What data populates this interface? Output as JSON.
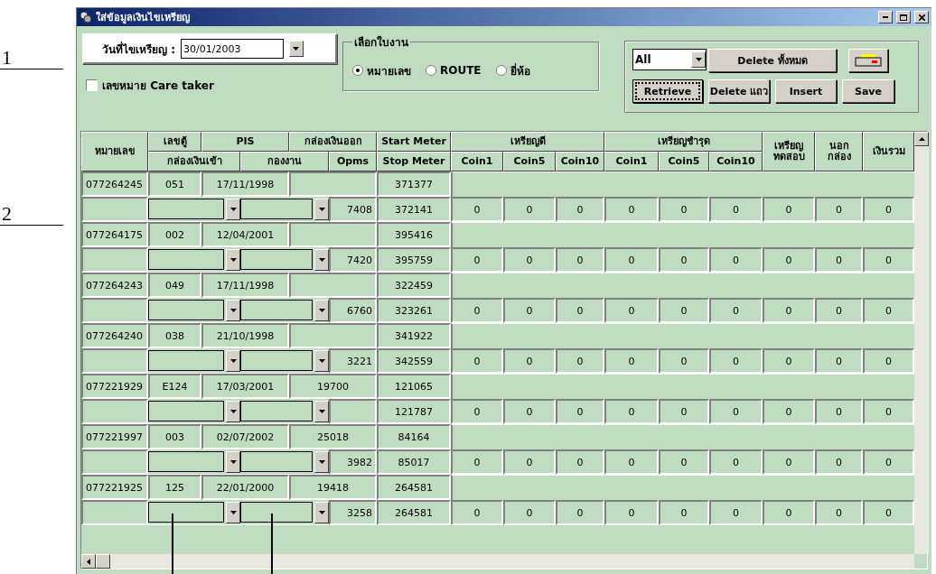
{
  "annotations": [
    {
      "label": "1"
    },
    {
      "label": "2"
    }
  ],
  "window": {
    "title": "ใส่ข้อมูลเงินไขเหรียญ"
  },
  "date_picker": {
    "label": "วันที่ไขเหรียญ :",
    "value": "30/01/2003"
  },
  "caretaker_checkbox": {
    "label": "เลขหมาย Care taker",
    "checked": false
  },
  "worksheet_group": {
    "title": "เลือกใบงาน",
    "options": [
      {
        "label": "หมายเลข",
        "selected": true
      },
      {
        "label": "ROUTE",
        "selected": false
      },
      {
        "label": "ยี่ห้อ",
        "selected": false
      }
    ]
  },
  "filter": {
    "value": "All"
  },
  "buttons": [
    {
      "kind": "text",
      "label": "Delete ทั้งหมด",
      "focused": false
    },
    {
      "kind": "print",
      "focused": false
    },
    {
      "kind": "text",
      "label": "Retrieve",
      "focused": true
    },
    {
      "kind": "text",
      "label": "Delete แถว",
      "focused": false
    },
    {
      "kind": "text",
      "label": "Insert",
      "focused": false
    },
    {
      "kind": "text",
      "label": "Save",
      "focused": false
    }
  ],
  "table": {
    "header_top": [
      "หมายเลข",
      "เลขตู้",
      "PIS",
      "กล่องเงินออก",
      "Start Meter",
      "เหรียญดี",
      "เหรียญชำรุด",
      "เหรียญ ทดสอบ",
      "นอก กล่อง",
      "เงินรวม"
    ],
    "header_bottom": [
      "กล่องเงินเข้า",
      "กองงาน",
      "Opms",
      "Stop Meter",
      "Coin1",
      "Coin5",
      "Coin10",
      "Coin1",
      "Coin5",
      "Coin10"
    ],
    "records": [
      {
        "number": "077264245",
        "cabinet": "051",
        "date": "17/11/1998",
        "start_meter": "371377",
        "opms": "7408",
        "stop_meter": "372141",
        "coins": [
          "0",
          "0",
          "0",
          "0",
          "0",
          "0",
          "0",
          "0",
          "0"
        ]
      },
      {
        "number": "077264175",
        "cabinet": "002",
        "date": "12/04/2001",
        "start_meter": "395416",
        "opms": "7420",
        "stop_meter": "395759",
        "coins": [
          "0",
          "0",
          "0",
          "0",
          "0",
          "0",
          "0",
          "0",
          "0"
        ]
      },
      {
        "number": "077264243",
        "cabinet": "049",
        "date": "17/11/1998",
        "start_meter": "322459",
        "opms": "6760",
        "stop_meter": "323261",
        "coins": [
          "0",
          "0",
          "0",
          "0",
          "0",
          "0",
          "0",
          "0",
          "0"
        ]
      },
      {
        "number": "077264240",
        "cabinet": "038",
        "date": "21/10/1998",
        "start_meter": "341922",
        "opms": "3221",
        "stop_meter": "342559",
        "coins": [
          "0",
          "0",
          "0",
          "0",
          "0",
          "0",
          "0",
          "0",
          "0"
        ]
      },
      {
        "number": "077221929",
        "cabinet": "E124",
        "date": "17/03/2001",
        "box_out": "19700",
        "start_meter": "121065",
        "stop_meter": "121787",
        "coins": [
          "0",
          "0",
          "0",
          "0",
          "0",
          "0",
          "0",
          "0",
          "0"
        ]
      },
      {
        "number": "077221997",
        "cabinet": "003",
        "date": "02/07/2002",
        "box_out": "25018",
        "start_meter": "84164",
        "opms": "3982",
        "stop_meter": "85017",
        "coins": [
          "0",
          "0",
          "0",
          "0",
          "0",
          "0",
          "0",
          "0",
          "0"
        ]
      },
      {
        "number": "077221925",
        "cabinet": "125",
        "date": "22/01/2000",
        "box_out": "19418",
        "start_meter": "264581",
        "opms": "3258",
        "stop_meter": "264581",
        "coins": [
          "0",
          "0",
          "0",
          "0",
          "0",
          "0",
          "0",
          "0",
          "0"
        ]
      }
    ]
  }
}
